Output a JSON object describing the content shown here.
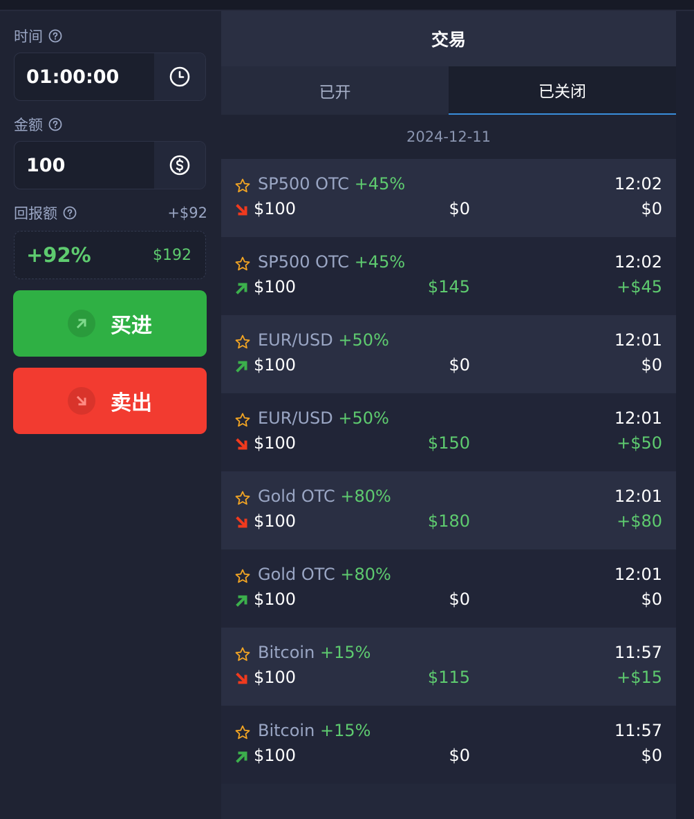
{
  "left_panel": {
    "time_label": "时间",
    "time_value": "01:00:00",
    "amount_label": "金额",
    "amount_value": "100",
    "payout_label": "回报额",
    "payout_profit": "+$92",
    "payout_percent": "+92%",
    "payout_total": "$192",
    "buy_label": "买进",
    "sell_label": "卖出"
  },
  "trades_panel": {
    "title": "交易",
    "tabs": [
      {
        "label": "已开",
        "active": false
      },
      {
        "label": "已关闭",
        "active": true
      }
    ],
    "date": "2024-12-11",
    "trades": [
      {
        "asset": "SP500 OTC",
        "pct": "+45%",
        "time": "12:02",
        "direction": "down",
        "amount": "$100",
        "result": "$0",
        "profit": "$0"
      },
      {
        "asset": "SP500 OTC",
        "pct": "+45%",
        "time": "12:02",
        "direction": "up",
        "amount": "$100",
        "result": "$145",
        "profit": "+$45"
      },
      {
        "asset": "EUR/USD",
        "pct": "+50%",
        "time": "12:01",
        "direction": "up",
        "amount": "$100",
        "result": "$0",
        "profit": "$0"
      },
      {
        "asset": "EUR/USD",
        "pct": "+50%",
        "time": "12:01",
        "direction": "down",
        "amount": "$100",
        "result": "$150",
        "profit": "+$50"
      },
      {
        "asset": "Gold OTC",
        "pct": "+80%",
        "time": "12:01",
        "direction": "down",
        "amount": "$100",
        "result": "$180",
        "profit": "+$80"
      },
      {
        "asset": "Gold OTC",
        "pct": "+80%",
        "time": "12:01",
        "direction": "up",
        "amount": "$100",
        "result": "$0",
        "profit": "$0"
      },
      {
        "asset": "Bitcoin",
        "pct": "+15%",
        "time": "11:57",
        "direction": "down",
        "amount": "$100",
        "result": "$115",
        "profit": "+$15"
      },
      {
        "asset": "Bitcoin",
        "pct": "+15%",
        "time": "11:57",
        "direction": "up",
        "amount": "$100",
        "result": "$0",
        "profit": "$0"
      }
    ]
  },
  "icons": {
    "help": "help-circle-icon",
    "time": "clock-icon",
    "amount": "dollar-circle-icon",
    "favorite": "star-outline-icon",
    "up": "arrow-up-right-icon",
    "down": "arrow-down-right-icon"
  },
  "colors": {
    "background": "#1f2333",
    "buy": "#2fb044",
    "sell": "#f23b30",
    "profit_green": "#5ecb6f",
    "star_orange": "#f5a623",
    "arrow_up": "#3cb04c",
    "arrow_down": "#f03a1e",
    "active_tab_underline": "#3a8fdc"
  }
}
